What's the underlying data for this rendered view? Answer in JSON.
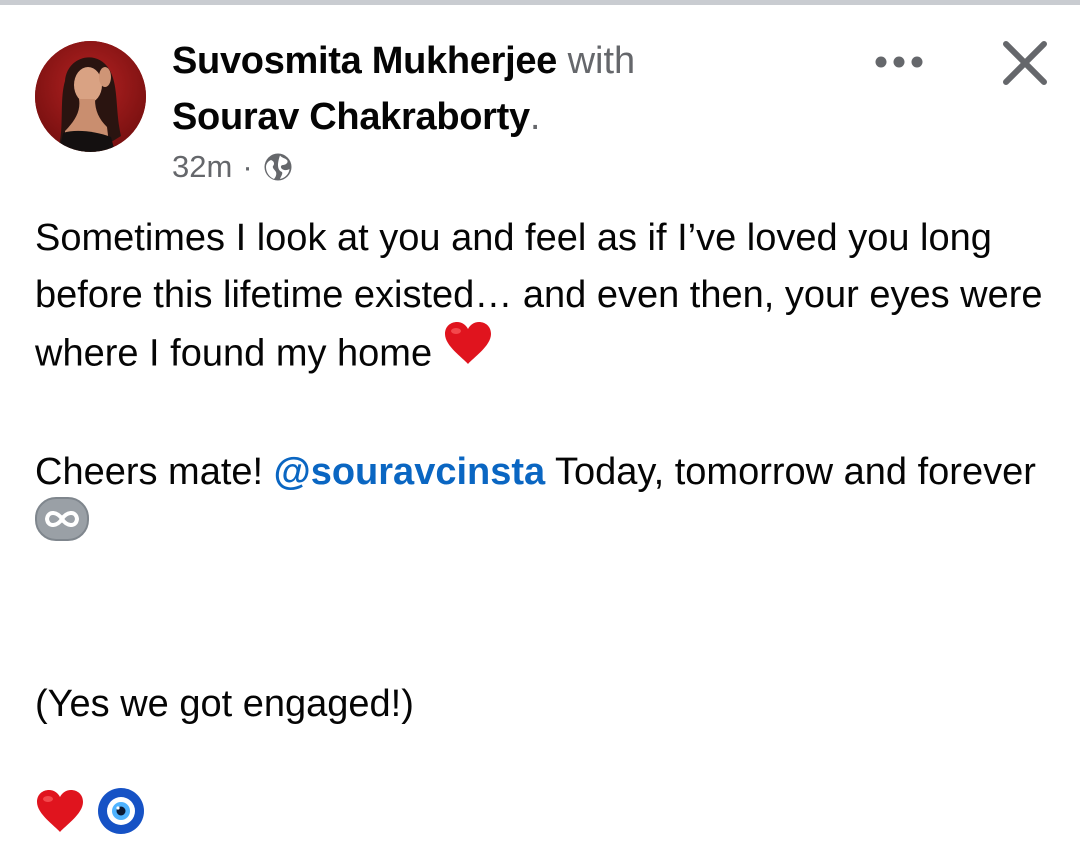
{
  "header": {
    "author_name": "Suvosmita Mukherjee",
    "with_text": "with",
    "tagged_name": "Sourav Chakraborty",
    "tagged_suffix": ".",
    "timestamp": "32m",
    "separator": "·",
    "audience_icon": "globe-icon",
    "more_icon": "more-options-icon",
    "close_icon": "close-icon"
  },
  "post": {
    "paragraph1": "Sometimes I look at you and feel as if I’ve loved you long before this lifetime existed… and even then, your eyes were where I found my home",
    "paragraph1_emoji": "red-heart-emoji",
    "paragraph2_pre": "Cheers mate!",
    "mention": "@souravcinsta",
    "paragraph2_post": "Today, tomorrow and forever",
    "paragraph2_emoji": "infinity-emoji",
    "paragraph3": "(Yes we got engaged!)",
    "paragraph4_emojis": [
      "red-heart-emoji",
      "nazar-amulet-emoji"
    ]
  },
  "colors": {
    "link": "#0a66c2",
    "secondary_text": "#65676b",
    "primary_text": "#050505",
    "heart": "#e0141e"
  }
}
